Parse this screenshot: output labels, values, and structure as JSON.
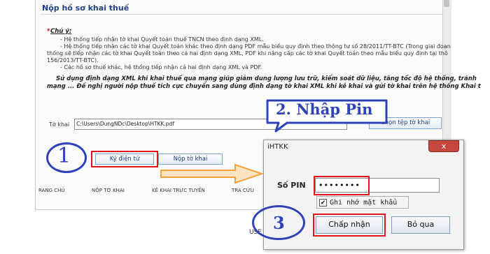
{
  "page": {
    "title": "Nộp hồ sơ khai thuế",
    "note_star": "*",
    "note_title": "Chú ý:",
    "notes": [
      "- Hệ thống tiếp nhận tờ khai Quyết toán thuế TNCN theo định dạng XML.",
      "- Hệ thống tiếp nhận các tờ khai Quyết toán khác theo định dạng PDF mẫu biểu quy định theo thông tư số 28/2011/TT-BTC (Trong giai đoạn",
      "thống sẽ tiếp nhận các tờ khai Quyết toán theo cả hai định dạng XML, PDF khi nâng cấp các tờ khai Quyết toán theo mẫu biểu quy định tại thô",
      "156/2013/TT-BTC).",
      "- Các hồ sơ thuế khác, hệ thống tiếp nhận cả hai định dạng XML và PDF."
    ],
    "advice_line1": "Sử dụng định dạng XML khi khai thuế qua mạng giúp giảm dung lượng lưu trữ, kiểm soát dữ liệu, tăng tốc độ hệ thống, tránh",
    "advice_line2": "mạng ... Đề nghị người nộp thuế tích cực chuyển sang dùng định dạng tờ khai XML khi kê khai và gửi tờ khai trên hệ thống Khai t",
    "file_label": "Tờ khai",
    "file_path": "C:\\Users\\DungNDc\\Desktop\\HTKK.pdf",
    "choose_file_button": "Chọn tệp tờ khai",
    "sign_button": "Ký điện tử",
    "submit_button": "Nộp tờ khai",
    "nav": [
      "RANG CHỦ",
      "NỘP TỜ KHAI",
      "KÊ KHAI TRỰC TUYẾN",
      "TRA CỨU"
    ],
    "bottom_text": "USE"
  },
  "annotations": {
    "step1": "1",
    "step2": "2. Nhập Pin",
    "step3": "3",
    "color": "#2f42b8",
    "highlight_color": "#e2141e"
  },
  "dialog": {
    "title": "iHTKK",
    "close": "x",
    "pin_label": "Số PIN",
    "pin_value": "••••••••",
    "remember_check": "✔",
    "remember_label": "Ghi nhớ mật khẩu",
    "ok_button": "Chấp nhận",
    "cancel_button": "Bỏ qua"
  }
}
